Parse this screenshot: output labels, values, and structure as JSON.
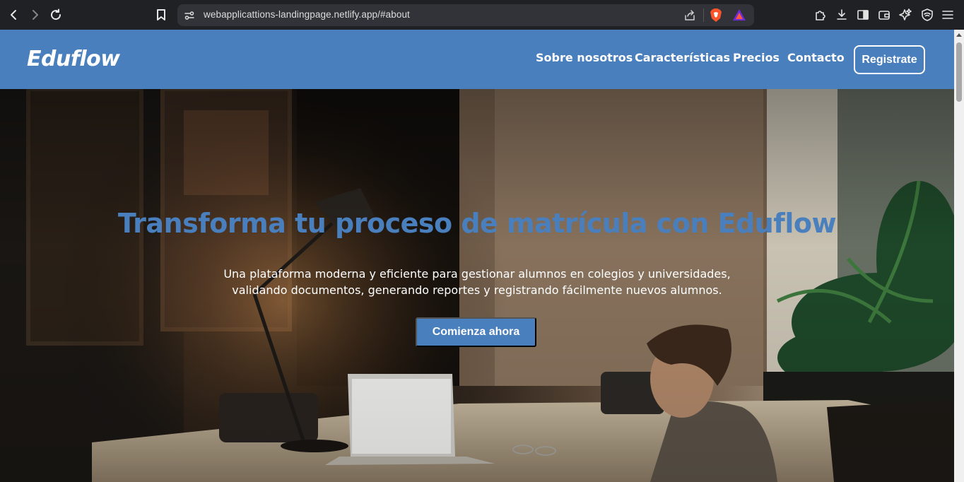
{
  "browser": {
    "url": "webapplicattions-landingpage.netlify.app/#about"
  },
  "header": {
    "logo": "Eduflow",
    "nav": [
      {
        "label": "Sobre nosotros"
      },
      {
        "label": "Características"
      },
      {
        "label": "Precios"
      },
      {
        "label": "Contacto"
      }
    ],
    "register_label": "Registrate"
  },
  "hero": {
    "title": "Transforma tu proceso de matrícula con Eduflow",
    "subtitle": "Una plataforma moderna y eficiente para gestionar alumnos en colegios y universidades, validando documentos, generando reportes y registrando fácilmente nuevos alumnos.",
    "cta_label": "Comienza ahora"
  },
  "colors": {
    "brand": "#4a7fbd",
    "chrome": "#202124"
  }
}
